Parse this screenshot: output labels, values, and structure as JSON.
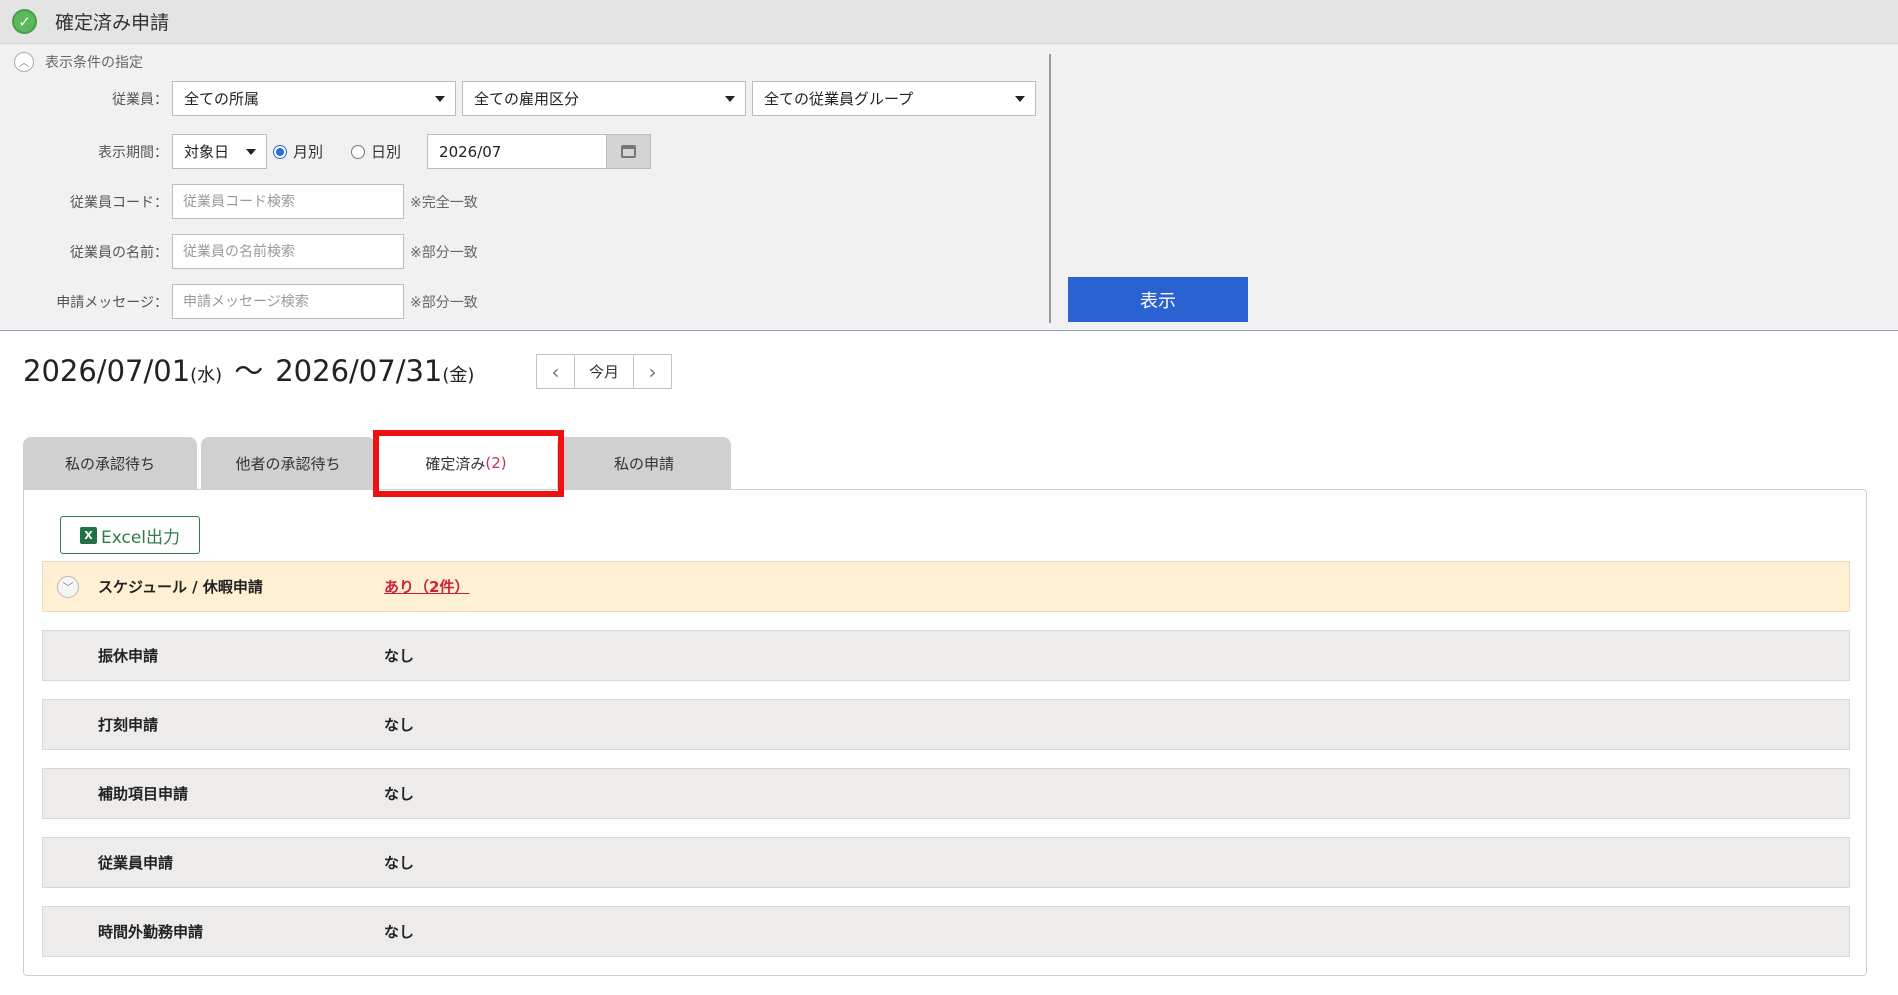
{
  "page_title": "確定済み申請",
  "filter": {
    "toggle_label": "表示条件の指定",
    "employee_label": "従業員：",
    "affiliation": "全ての所属",
    "employment_type": "全ての雇用区分",
    "employee_group": "全ての従業員グループ",
    "period_label": "表示期間：",
    "period_type": "対象日",
    "radio_monthly": "月別",
    "radio_daily": "日別",
    "date_value": "2026/07",
    "code_label": "従業員コード：",
    "code_placeholder": "従業員コード検索",
    "code_note": "※完全一致",
    "name_label": "従業員の名前：",
    "name_placeholder": "従業員の名前検索",
    "name_note": "※部分一致",
    "message_label": "申請メッセージ：",
    "message_placeholder": "申請メッセージ検索",
    "message_note": "※部分一致",
    "show_button": "表示"
  },
  "period": {
    "start": "2026/07/01",
    "start_dow": "(水)",
    "tilde": "〜",
    "end": "2026/07/31",
    "end_dow": "(金)",
    "this_month": "今月"
  },
  "tabs": {
    "my_approval": "私の承認待ち",
    "others_approval": "他者の承認待ち",
    "confirmed": "確定済み",
    "confirmed_count": "(2)",
    "my_requests": "私の申請"
  },
  "excel_label": "Excel出力",
  "requests": [
    {
      "name": "スケジュール / 休暇申請",
      "value": "あり（2件）"
    },
    {
      "name": "振休申請",
      "value": "なし"
    },
    {
      "name": "打刻申請",
      "value": "なし"
    },
    {
      "name": "補助項目申請",
      "value": "なし"
    },
    {
      "name": "従業員申請",
      "value": "なし"
    },
    {
      "name": "時間外勤務申請",
      "value": "なし"
    }
  ],
  "colors": {
    "primary_button": "#2b62d2",
    "highlight_box": "#ee1111",
    "link_red": "#d0213b",
    "excel_green": "#2e7d46"
  }
}
